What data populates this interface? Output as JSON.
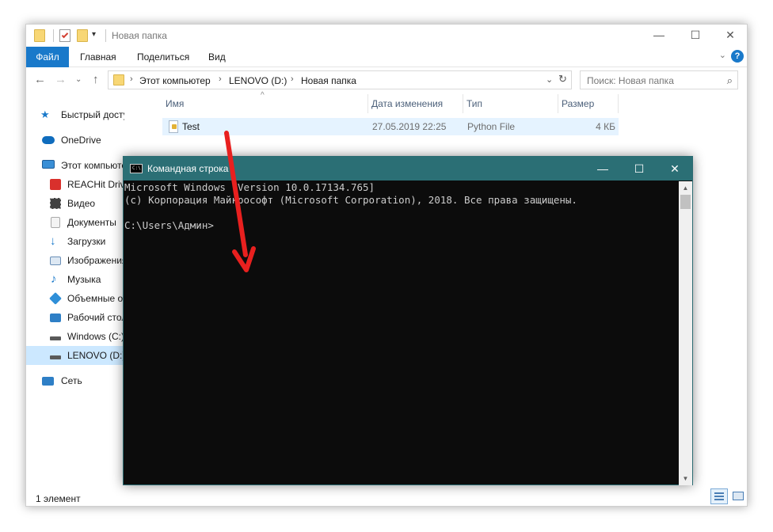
{
  "explorer": {
    "window_title": "Новая папка",
    "controls": {
      "minimize": "—",
      "maximize": "☐",
      "close": "✕"
    },
    "ribbon": {
      "file": "Файл",
      "tabs": [
        "Главная",
        "Поделиться",
        "Вид"
      ],
      "help": "?",
      "expand": "⌄"
    },
    "nav": {
      "back": "←",
      "forward": "→",
      "dropdown": "⌄",
      "up": "↑"
    },
    "breadcrumb": [
      "Этот компьютер",
      "LENOVO (D:)",
      "Новая папка"
    ],
    "breadcrumb_sep": "›",
    "address_dropdown": "⌄",
    "refresh": "↻",
    "search": {
      "placeholder": "Поиск: Новая папка",
      "icon": "⌕"
    },
    "sidebar": [
      {
        "label": "Быстрый доступ",
        "icon": "star-icon",
        "color": "#1979ca"
      },
      {
        "label": "OneDrive",
        "icon": "cloud-icon",
        "color": "#0f6cbd"
      },
      {
        "label": "Этот компьютер",
        "icon": "computer-icon",
        "color": "#3a8fd6"
      },
      {
        "label": "REACHit Drive",
        "icon": "reachit-icon",
        "color": "#d9302c"
      },
      {
        "label": "Видео",
        "icon": "film-icon",
        "color": "#404040"
      },
      {
        "label": "Документы",
        "icon": "document-icon",
        "color": "#a9a9a9"
      },
      {
        "label": "Загрузки",
        "icon": "download-icon",
        "color": "#1979ca"
      },
      {
        "label": "Изображения",
        "icon": "picture-icon",
        "color": "#6a8fb7"
      },
      {
        "label": "Музыка",
        "icon": "music-icon",
        "color": "#1979ca"
      },
      {
        "label": "Объемные объекты",
        "icon": "cube-icon",
        "color": "#2f8fd8"
      },
      {
        "label": "Рабочий стол",
        "icon": "desktop-icon",
        "color": "#2e7fc6"
      },
      {
        "label": "Windows (C:)",
        "icon": "drive-c-icon",
        "color": "#5a5a5a"
      },
      {
        "label": "LENOVO (D:)",
        "icon": "drive-d-icon",
        "color": "#5a5a5a"
      },
      {
        "label": "Сеть",
        "icon": "network-icon",
        "color": "#2e7fc6"
      }
    ],
    "columns": {
      "name": "Имя",
      "modified": "Дата изменения",
      "type": "Тип",
      "size": "Размер"
    },
    "sort_indicator": "^",
    "files": [
      {
        "name": "Test",
        "modified": "27.05.2019 22:25",
        "type": "Python File",
        "size": "4 КБ"
      }
    ],
    "status": "1 элемент"
  },
  "cmd": {
    "title": "Командная строка",
    "icon_text": "C:\\",
    "controls": {
      "minimize": "—",
      "maximize": "☐",
      "close": "✕"
    },
    "lines": [
      "Microsoft Windows [Version 10.0.17134.765]",
      "(c) Корпорация Майкрософт (Microsoft Corporation), 2018. Все права защищены.",
      "",
      "C:\\Users\\Админ>"
    ],
    "scroll": {
      "up": "▲",
      "down": "▼"
    }
  },
  "annotation": {
    "arrow_color": "#e8201f"
  },
  "colors": {
    "accent": "#1979ca",
    "cmd_title": "#2b6f75",
    "selection": "#cce8ff"
  }
}
